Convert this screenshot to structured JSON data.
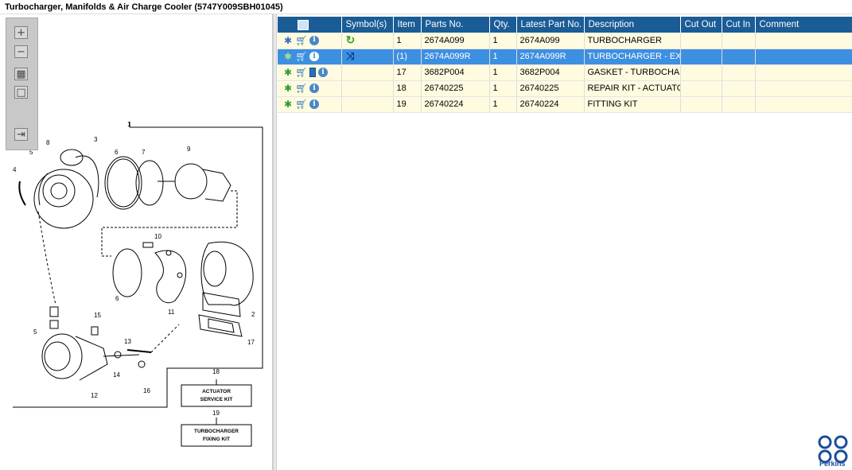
{
  "window": {
    "title": "Turbocharger, Manifolds & Air Charge Cooler (5747Y009SBH01045)"
  },
  "zoom_toolbar": {
    "buttons": [
      {
        "name": "zoom-in",
        "glyph": "+"
      },
      {
        "name": "zoom-out",
        "glyph": "−"
      },
      {
        "name": "fit-all",
        "glyph": "▦"
      },
      {
        "name": "fit-box",
        "glyph": "□"
      },
      {
        "name": "export",
        "glyph": "⇥"
      }
    ]
  },
  "drawing": {
    "callouts": [
      "1",
      "2",
      "3",
      "4",
      "5",
      "5",
      "6",
      "6",
      "7",
      "8",
      "9",
      "10",
      "11",
      "12",
      "13",
      "14",
      "15",
      "16",
      "17",
      "18",
      "19"
    ],
    "kit_boxes": [
      {
        "number": "18",
        "line1": "ACTUATOR",
        "line2": "SERVICE KIT"
      },
      {
        "number": "19",
        "line1": "TURBOCHARGER",
        "line2": "FIXING KIT"
      }
    ]
  },
  "grid": {
    "columns": [
      "",
      "Symbol(s)",
      "Item",
      "Parts No.",
      "Qty.",
      "Latest Part No.",
      "Description",
      "Cut Out",
      "Cut In",
      "Comment"
    ],
    "rows": [
      {
        "icons": [
          "gear-blue",
          "cart",
          "info"
        ],
        "symbol": "rotate-arrow",
        "item": "1",
        "part_no": "2674A099",
        "qty": "1",
        "latest_part_no": "2674A099",
        "description": "TURBOCHARGER",
        "cut_out": "",
        "cut_in": "",
        "comment": "",
        "selected": false
      },
      {
        "icons": [
          "gear",
          "cart",
          "info"
        ],
        "symbol": "exchange-arrow",
        "item": "(1)",
        "part_no": "2674A099R",
        "qty": "1",
        "latest_part_no": "2674A099R",
        "description": "TURBOCHARGER - EXCH",
        "cut_out": "",
        "cut_in": "",
        "comment": "",
        "selected": true
      },
      {
        "icons": [
          "gear",
          "cart",
          "book",
          "info"
        ],
        "symbol": "",
        "item": "17",
        "part_no": "3682P004",
        "qty": "1",
        "latest_part_no": "3682P004",
        "description": "GASKET - TURBOCHARG",
        "cut_out": "",
        "cut_in": "",
        "comment": "",
        "selected": false
      },
      {
        "icons": [
          "gear",
          "cart",
          "info"
        ],
        "symbol": "",
        "item": "18",
        "part_no": "26740225",
        "qty": "1",
        "latest_part_no": "26740225",
        "description": "REPAIR KIT - ACTUATOR",
        "cut_out": "",
        "cut_in": "",
        "comment": "",
        "selected": false
      },
      {
        "icons": [
          "gear",
          "cart",
          "info"
        ],
        "symbol": "",
        "item": "19",
        "part_no": "26740224",
        "qty": "1",
        "latest_part_no": "26740224",
        "description": "FITTING KIT",
        "cut_out": "",
        "cut_in": "",
        "comment": "",
        "selected": false
      }
    ]
  },
  "brand": {
    "name": "Perkins",
    "color": "#1a4f9a"
  },
  "colors": {
    "header": "#1a5c96",
    "row": "#fffbe0",
    "selected": "#3d8fe0"
  }
}
